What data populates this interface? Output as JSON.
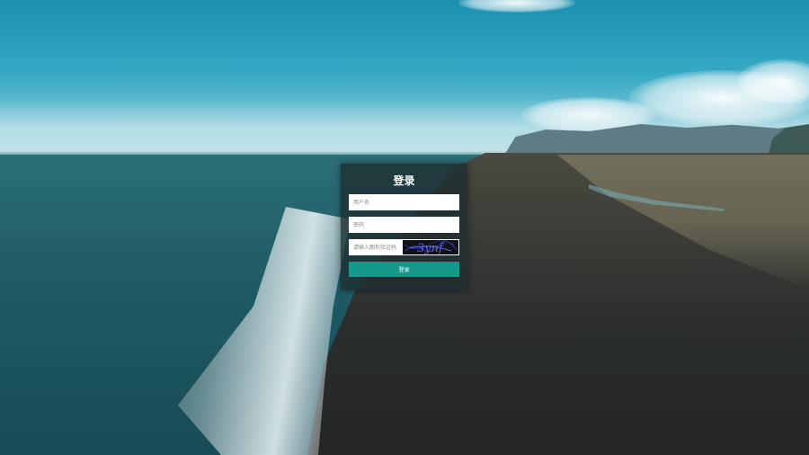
{
  "login": {
    "title": "登录",
    "username_placeholder": "用户名",
    "password_placeholder": "密码",
    "captcha_placeholder": "请输入图形验证码",
    "captcha_text": "3ynf",
    "submit_label": "登录"
  },
  "colors": {
    "button": "#14998a",
    "panel": "rgba(30,45,48,0.78)"
  }
}
